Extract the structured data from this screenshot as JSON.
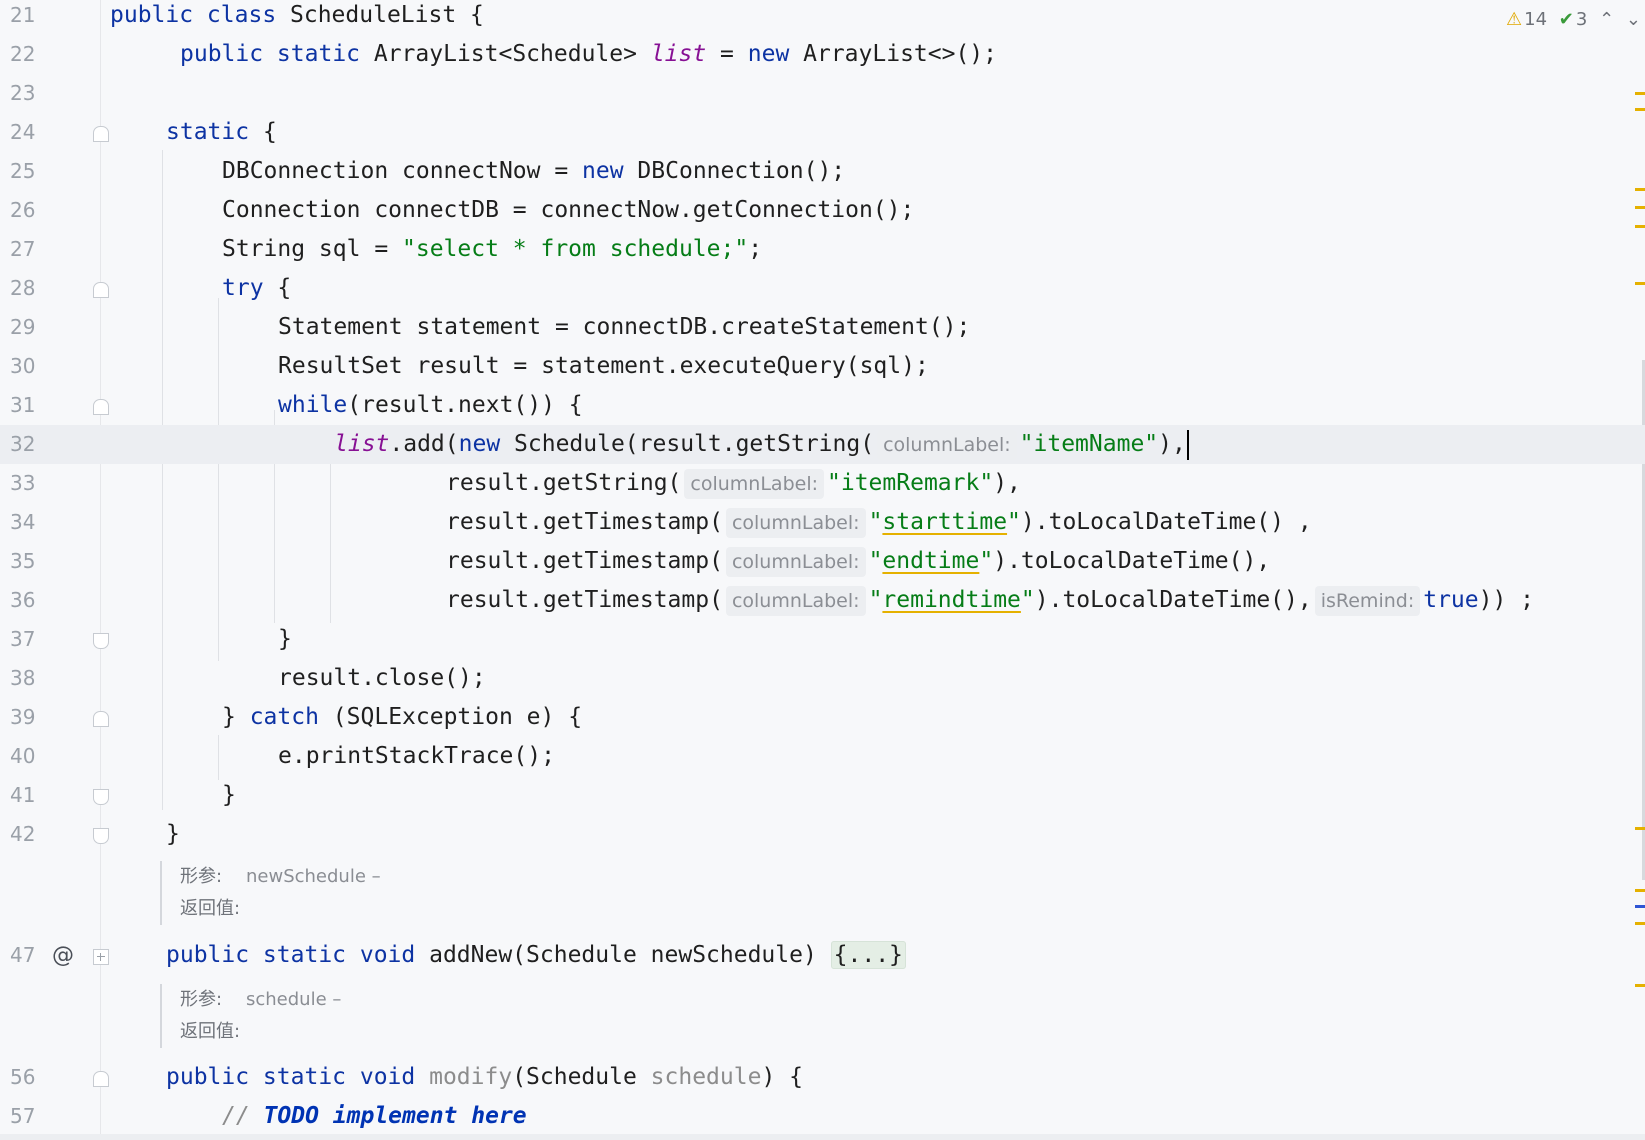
{
  "editor": {
    "inspections": {
      "warnings": "14",
      "ok": "3"
    },
    "lines": [
      {
        "n": "21"
      },
      {
        "n": "22"
      },
      {
        "n": "23"
      },
      {
        "n": "24"
      },
      {
        "n": "25"
      },
      {
        "n": "26"
      },
      {
        "n": "27"
      },
      {
        "n": "28"
      },
      {
        "n": "29"
      },
      {
        "n": "30"
      },
      {
        "n": "31"
      },
      {
        "n": "32"
      },
      {
        "n": "33"
      },
      {
        "n": "34"
      },
      {
        "n": "35"
      },
      {
        "n": "36"
      },
      {
        "n": "37"
      },
      {
        "n": "38"
      },
      {
        "n": "39"
      },
      {
        "n": "40"
      },
      {
        "n": "41"
      },
      {
        "n": "42"
      },
      {
        "n": "47"
      },
      {
        "n": "56"
      },
      {
        "n": "57"
      }
    ],
    "gutter_at": "@",
    "code": {
      "l21": {
        "kw1": "public class",
        "txt": " ScheduleList {"
      },
      "l22": {
        "kw1": "public static",
        "t1": " ArrayList<Schedule> ",
        "fld": "list",
        "t2": " = ",
        "kw2": "new",
        "t3": " ArrayList<>();"
      },
      "l24": {
        "kw": "static",
        "t": " {"
      },
      "l25": {
        "t1": "DBConnection connectNow = ",
        "kw": "new",
        "t2": " DBConnection();"
      },
      "l26": {
        "t": "Connection connectDB = connectNow.getConnection();"
      },
      "l27": {
        "t1": "String sql = ",
        "str": "\"select * from schedule;\"",
        "t2": ";"
      },
      "l28": {
        "kw": "try",
        "t": " {"
      },
      "l29": {
        "t": "Statement statement = connectDB.createStatement();"
      },
      "l30": {
        "t": "ResultSet result = statement.executeQuery(sql);"
      },
      "l31": {
        "kw": "while",
        "t": "(result.next()) {"
      },
      "l32": {
        "fld": "list",
        "t1": ".add(",
        "kw": "new",
        "t2": " Schedule(result.getString(",
        "hint": "columnLabel:",
        "str": "\"itemName\"",
        "t3": "),"
      },
      "l33": {
        "t1": "result.getString(",
        "hint": "columnLabel:",
        "str": "\"itemRemark\"",
        "t2": "),"
      },
      "l34": {
        "t1": "result.getTimestamp(",
        "hint": "columnLabel:",
        "q1": "\"",
        "sq": "starttime",
        "q2": "\"",
        "t2": ").toLocalDateTime() ,"
      },
      "l35": {
        "t1": "result.getTimestamp(",
        "hint": "columnLabel:",
        "q1": "\"",
        "sq": "endtime",
        "q2": "\"",
        "t2": ").toLocalDateTime(),"
      },
      "l36": {
        "t1": "result.getTimestamp(",
        "hint": "columnLabel:",
        "q1": "\"",
        "sq": "remindtime",
        "q2": "\"",
        "t2": ").toLocalDateTime(),",
        "hint2": "isRemind:",
        "kw": "true",
        "t3": ")) ;"
      },
      "l37": {
        "t": "}"
      },
      "l38": {
        "t": "result.close();"
      },
      "l39": {
        "t1": "} ",
        "kw": "catch",
        "t2": " (SQLException e) {"
      },
      "l40": {
        "t": "e.printStackTrace();"
      },
      "l41": {
        "t": "}"
      },
      "l42": {
        "t": "}"
      },
      "doc1": {
        "param_label": "形参:",
        "param_val": "newSchedule –",
        "ret_label": "返回值:"
      },
      "l47": {
        "kw": "public static void",
        "t": " addNew(Schedule newSchedule) ",
        "folded": "{...}"
      },
      "doc2": {
        "param_label": "形参:",
        "param_val": "schedule –",
        "ret_label": "返回值:"
      },
      "l56": {
        "kw": "public static void",
        "m": " modify",
        "t1": "(Schedule ",
        "p": "schedule",
        "t2": ") {"
      },
      "l57": {
        "c": "// ",
        "todo": "TODO implement here"
      }
    }
  }
}
